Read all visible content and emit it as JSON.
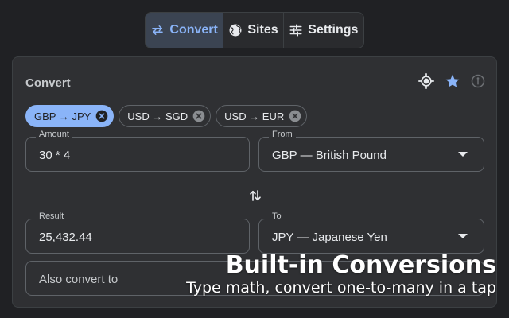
{
  "tabs": [
    {
      "label": "Convert",
      "icon": "swap-horizontal-icon",
      "active": true
    },
    {
      "label": "Sites",
      "icon": "globe-icon",
      "active": false
    },
    {
      "label": "Settings",
      "icon": "sliders-icon",
      "active": false
    }
  ],
  "card": {
    "title": "Convert",
    "icons": [
      "target-icon",
      "star-icon",
      "info-icon"
    ]
  },
  "chips": [
    {
      "label": "GBP → JPY",
      "active": true
    },
    {
      "label": "USD → SGD",
      "active": false
    },
    {
      "label": "USD → EUR",
      "active": false
    }
  ],
  "amount": {
    "label": "Amount",
    "value": "30 * 4"
  },
  "from": {
    "label": "From",
    "value": "GBP — British Pound"
  },
  "result": {
    "label": "Result",
    "value": "25,432.44"
  },
  "to": {
    "label": "To",
    "value": "JPY — Japanese Yen"
  },
  "also_convert": {
    "placeholder": "Also convert to"
  },
  "promo": {
    "title": "Built-in Conversions",
    "subtitle": "Type math, convert one-to-many in a tap"
  },
  "colors": {
    "accent": "#8ab4f8",
    "background": "#202124",
    "card": "#2f3033"
  }
}
